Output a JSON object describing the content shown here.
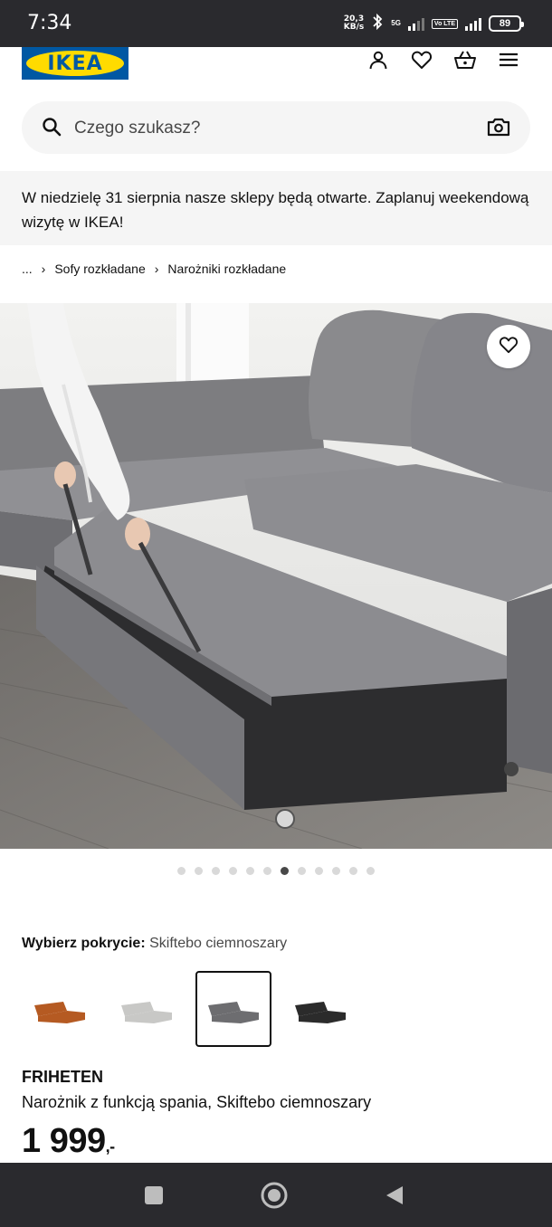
{
  "status_bar": {
    "time": "7:34",
    "net_speed_value": "20,3",
    "net_speed_unit": "KB/s",
    "network": "5G",
    "volte": "Vo LTE",
    "battery": "89"
  },
  "header": {
    "logo_text": "IKEA",
    "icons": [
      "user-icon",
      "heart-icon",
      "basket-icon",
      "menu-icon"
    ]
  },
  "search": {
    "placeholder": "Czego szukasz?"
  },
  "banner": {
    "text": "W niedzielę 31 sierpnia nasze sklepy będą otwarte. Zaplanuj weekendową wizytę w IKEA!"
  },
  "breadcrumb": {
    "items": [
      "...",
      "Sofy rozkładane",
      "Narożniki rozkładane"
    ]
  },
  "gallery": {
    "image_count": 12,
    "active_index": 6
  },
  "cover": {
    "label": "Wybierz pokrycie:",
    "value": "Skiftebo ciemnoszary",
    "options": [
      {
        "color": "#b55a22"
      },
      {
        "color": "#c8c8c6"
      },
      {
        "color": "#6d6d70",
        "selected": true
      },
      {
        "color": "#2b2b2b"
      }
    ]
  },
  "product": {
    "name": "FRIHETEN",
    "description": "Narożnik z funkcją spania, Skiftebo ciemnoszary",
    "price": "1 999",
    "price_suffix": ",-"
  },
  "colors": {
    "ikea_blue": "#0058a3",
    "ikea_yellow": "#ffdb00"
  }
}
